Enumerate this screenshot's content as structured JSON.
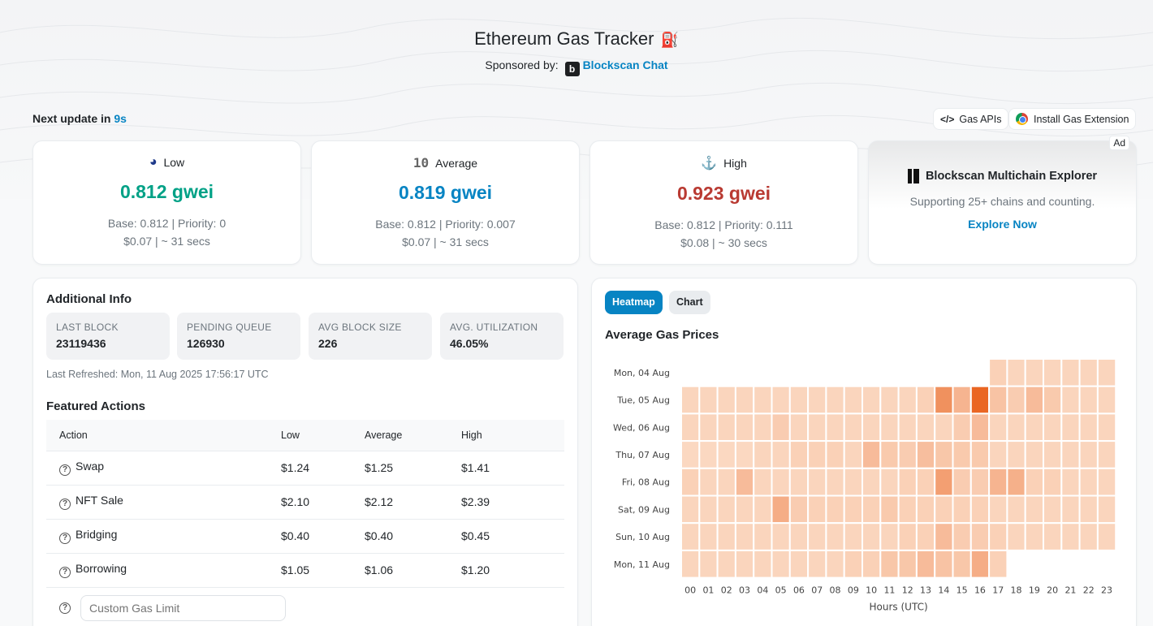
{
  "header": {
    "title": "Ethereum Gas Tracker",
    "title_icon": "gas-pump-icon",
    "sponsored_label": "Sponsored by:",
    "sponsor_logo": "b",
    "sponsor_name": "Blockscan Chat"
  },
  "update": {
    "label": "Next update in",
    "seconds": "9s"
  },
  "toolbar": {
    "gas_apis": "Gas APIs",
    "install_extension": "Install Gas Extension"
  },
  "gas_cards": [
    {
      "label": "Low",
      "icon": "rocket-tortoise-icon",
      "value": "0.812 gwei",
      "base_priority": "Base: 0.812 | Priority: 0",
      "cost_time": "$0.07 | ~ 31 secs",
      "color": "#00a186"
    },
    {
      "label": "Average",
      "icon": "10-icon",
      "value": "0.819 gwei",
      "base_priority": "Base: 0.812 | Priority: 0.007",
      "cost_time": "$0.07 | ~ 31 secs",
      "color": "#0784c3"
    },
    {
      "label": "High",
      "icon": "ship-icon",
      "value": "0.923 gwei",
      "base_priority": "Base: 0.812 | Priority: 0.111",
      "cost_time": "$0.08 | ~ 30 secs",
      "color": "#b93a32"
    }
  ],
  "ad": {
    "tag": "Ad",
    "title": "Blockscan Multichain Explorer",
    "text": "Supporting 25+ chains and counting.",
    "link": "Explore Now"
  },
  "additional_info": {
    "title": "Additional Info",
    "stats": [
      {
        "key": "LAST BLOCK",
        "value": "23119436"
      },
      {
        "key": "PENDING QUEUE",
        "value": "126930"
      },
      {
        "key": "AVG BLOCK SIZE",
        "value": "226"
      },
      {
        "key": "AVG. UTILIZATION",
        "value": "46.05%"
      }
    ],
    "last_refreshed": "Last Refreshed: Mon, 11 Aug 2025 17:56:17 UTC"
  },
  "featured_actions": {
    "title": "Featured Actions",
    "headers": [
      "Action",
      "Low",
      "Average",
      "High"
    ],
    "rows": [
      {
        "action": "Swap",
        "low": "$1.24",
        "average": "$1.25",
        "high": "$1.41"
      },
      {
        "action": "NFT Sale",
        "low": "$2.10",
        "average": "$2.12",
        "high": "$2.39"
      },
      {
        "action": "Bridging",
        "low": "$0.40",
        "average": "$0.40",
        "high": "$0.45"
      },
      {
        "action": "Borrowing",
        "low": "$1.05",
        "average": "$1.06",
        "high": "$1.20"
      }
    ],
    "custom_placeholder": "Custom Gas Limit"
  },
  "chart_tabs": {
    "heatmap": "Heatmap",
    "chart": "Chart",
    "active": "Heatmap"
  },
  "chart_data": {
    "type": "heatmap",
    "title": "Average Gas Prices",
    "xlabel": "Hours (UTC)",
    "ylabel": "",
    "x": [
      "00",
      "01",
      "02",
      "03",
      "04",
      "05",
      "06",
      "07",
      "08",
      "09",
      "10",
      "11",
      "12",
      "13",
      "14",
      "15",
      "16",
      "17",
      "18",
      "19",
      "20",
      "21",
      "22",
      "23"
    ],
    "y": [
      "Mon, 04 Aug",
      "Tue, 05 Aug",
      "Wed, 06 Aug",
      "Thu, 07 Aug",
      "Fri, 08 Aug",
      "Sat, 09 Aug",
      "Sun, 10 Aug",
      "Mon, 11 Aug"
    ],
    "intensity_scale": "relative 0-1 (light to dark orange)",
    "color_low": "#fde6d5",
    "color_high": "#e8580f",
    "values": [
      [
        null,
        null,
        null,
        null,
        null,
        null,
        null,
        null,
        null,
        null,
        null,
        null,
        null,
        null,
        null,
        null,
        null,
        0.15,
        0.12,
        0.12,
        0.12,
        0.12,
        0.12,
        0.12
      ],
      [
        0.12,
        0.12,
        0.12,
        0.12,
        0.12,
        0.12,
        0.12,
        0.12,
        0.12,
        0.12,
        0.12,
        0.12,
        0.12,
        0.15,
        0.6,
        0.35,
        0.9,
        0.25,
        0.18,
        0.3,
        0.2,
        0.12,
        0.12,
        0.12
      ],
      [
        0.12,
        0.12,
        0.12,
        0.12,
        0.12,
        0.18,
        0.12,
        0.12,
        0.12,
        0.12,
        0.12,
        0.12,
        0.12,
        0.12,
        0.12,
        0.18,
        0.3,
        0.12,
        0.12,
        0.12,
        0.12,
        0.12,
        0.12,
        0.12
      ],
      [
        0.1,
        0.1,
        0.1,
        0.1,
        0.12,
        0.12,
        0.15,
        0.15,
        0.15,
        0.12,
        0.3,
        0.2,
        0.18,
        0.28,
        0.22,
        0.2,
        0.2,
        0.12,
        0.12,
        0.12,
        0.12,
        0.12,
        0.12,
        0.12
      ],
      [
        0.15,
        0.12,
        0.12,
        0.3,
        0.12,
        0.12,
        0.12,
        0.12,
        0.12,
        0.12,
        0.12,
        0.12,
        0.15,
        0.15,
        0.5,
        0.18,
        0.18,
        0.35,
        0.38,
        0.15,
        0.15,
        0.12,
        0.12,
        0.12
      ],
      [
        0.12,
        0.12,
        0.12,
        0.12,
        0.12,
        0.4,
        0.18,
        0.15,
        0.15,
        0.15,
        0.15,
        0.2,
        0.15,
        0.15,
        0.15,
        0.15,
        0.15,
        0.12,
        0.12,
        0.12,
        0.12,
        0.12,
        0.12,
        0.12
      ],
      [
        0.12,
        0.12,
        0.12,
        0.12,
        0.12,
        0.12,
        0.12,
        0.12,
        0.12,
        0.12,
        0.12,
        0.12,
        0.15,
        0.15,
        0.3,
        0.18,
        0.18,
        0.15,
        0.12,
        0.12,
        0.12,
        0.12,
        0.12,
        0.12
      ],
      [
        0.12,
        0.12,
        0.12,
        0.12,
        0.12,
        0.12,
        0.12,
        0.12,
        0.12,
        0.15,
        0.15,
        0.22,
        0.22,
        0.3,
        0.25,
        0.22,
        0.4,
        0.15,
        null,
        null,
        null,
        null,
        null,
        null
      ]
    ]
  }
}
